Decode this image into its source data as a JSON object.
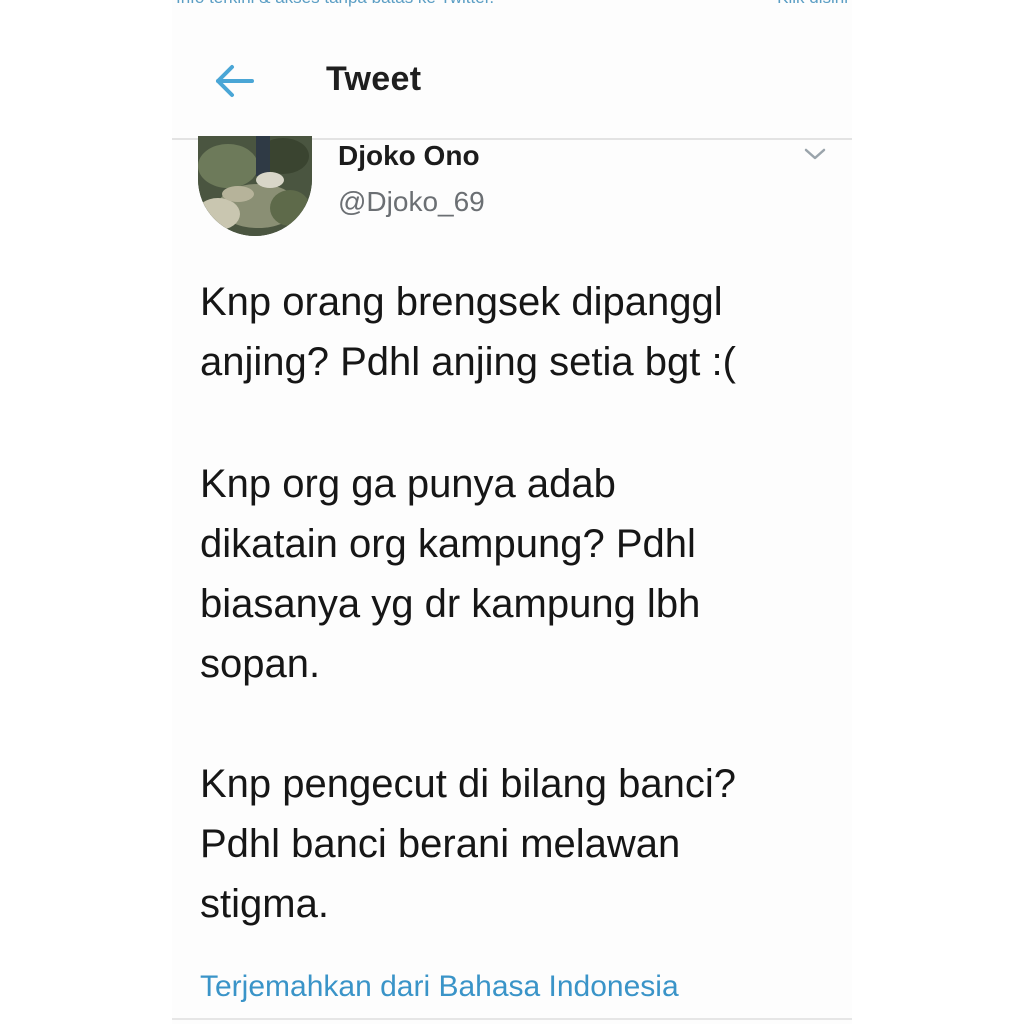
{
  "banner": {
    "text": "Info terkini & akses tanpa batas ke Twitter.",
    "link": "Klik disini"
  },
  "header": {
    "back_icon": "back-arrow-icon",
    "title": "Tweet"
  },
  "tweet": {
    "author": {
      "name": "Djoko Ono",
      "handle": "@Djoko_69"
    },
    "menu_icon": "chevron-down-icon",
    "paragraphs": [
      {
        "lines": [
          "Knp orang brengsek dipanggl",
          "anjing? Pdhl anjing setia bgt :("
        ]
      },
      {
        "lines": [
          "Knp org ga punya adab",
          "dikatain org kampung? Pdhl",
          "biasanya yg dr kampung lbh",
          "sopan."
        ]
      },
      {
        "lines": [
          "Knp pengecut di bilang banci?",
          "Pdhl banci berani melawan",
          "stigma."
        ]
      }
    ],
    "translate_link": "Terjemahkan dari Bahasa Indonesia"
  },
  "colors": {
    "accent": "#3a94c8",
    "back_arrow": "#4aa6d6",
    "text": "#161616",
    "muted": "#6b6f73"
  }
}
